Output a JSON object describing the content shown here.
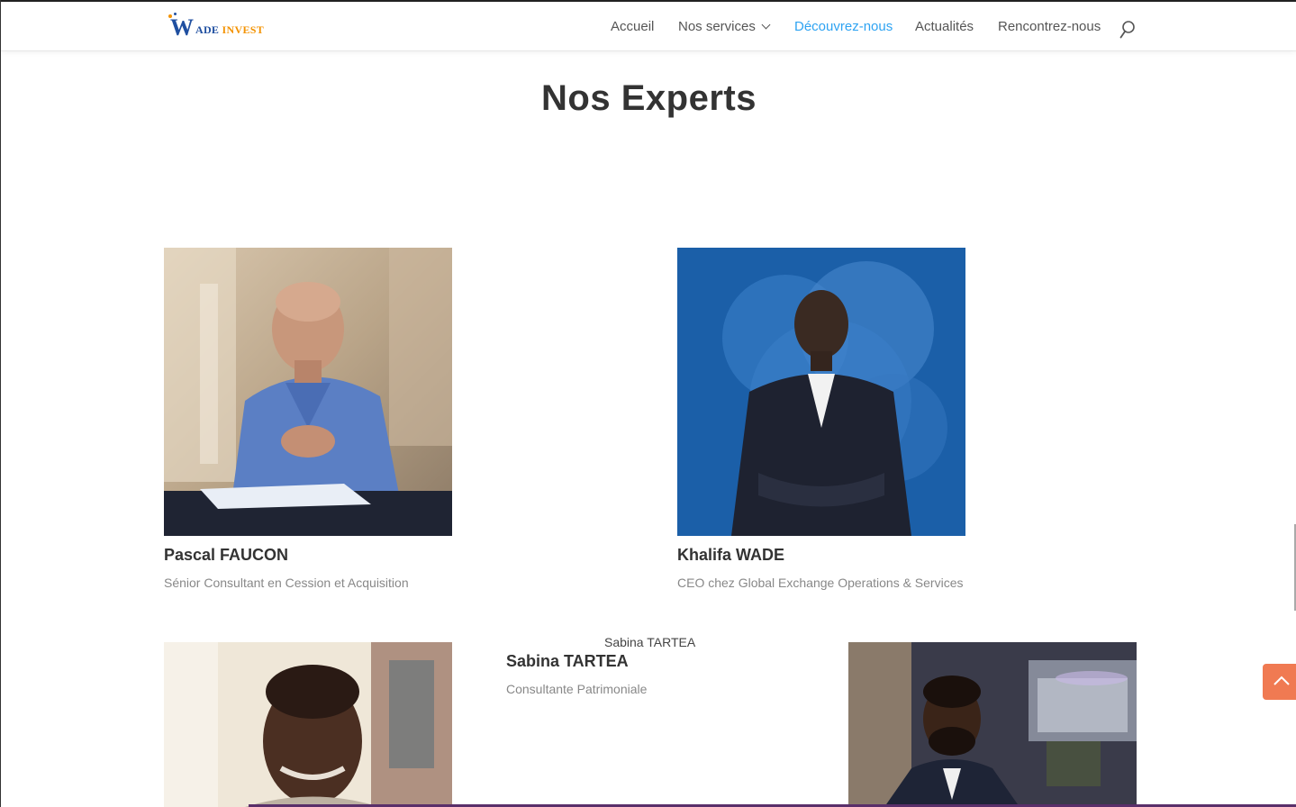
{
  "header": {
    "logo_w": "W",
    "logo_text_a": "ADE ",
    "logo_text_b": "INVEST",
    "nav": [
      {
        "label": "Accueil"
      },
      {
        "label": "Nos services"
      },
      {
        "label": "Découvrez-nous"
      },
      {
        "label": "Actualités"
      },
      {
        "label": "Rencontrez-nous"
      }
    ],
    "active_color": "#2ea3f2"
  },
  "section": {
    "title": "Nos Experts"
  },
  "experts": [
    {
      "name": "Pascal FAUCON",
      "role": "Sénior Consultant en Cession et Acquisition"
    },
    {
      "name": "Khalifa WADE",
      "role": "CEO chez Global Exchange Operations & Services"
    },
    {
      "name": "Sabina TARTEA",
      "role": "Consultante Patrimoniale",
      "tooltip": "Sabina TARTEA"
    }
  ],
  "icons": {
    "search": "search-icon",
    "back_to_top": "chevron-up-icon",
    "nav_dropdown": "chevron-down-icon"
  },
  "colors": {
    "accent": "#2ea3f2",
    "back_to_top": "#f07a52",
    "brand_blue": "#1f4fa0",
    "brand_orange": "#f39200"
  }
}
